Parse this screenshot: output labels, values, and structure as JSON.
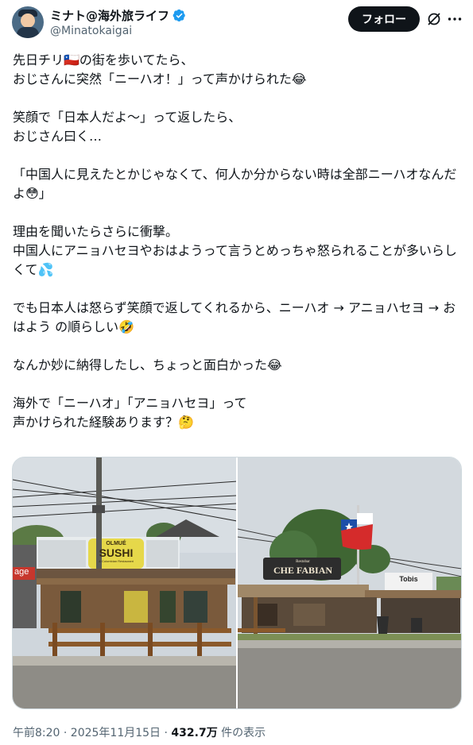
{
  "author": {
    "display_name": "ミナト@海外旅ライフ",
    "handle": "@Minatokaigai",
    "verified_color": "#1d9bf0"
  },
  "actions": {
    "follow_label": "フォロー",
    "grok_icon": "grok-icon",
    "more_icon": "more-icon"
  },
  "tweet": {
    "paragraphs": [
      "先日チリ🇨🇱の街を歩いてたら、\nおじさんに突然「ニーハオ！」って声かけられた😂",
      "笑顔で「日本人だよ〜」って返したら、\nおじさん曰く…",
      "「中国人に見えたとかじゃなくて、何人か分からない時は全部ニーハオなんだよ😳」",
      "理由を聞いたらさらに衝撃。\n中国人にアニョハセヨやおはようって言うとめっちゃ怒られることが多いらしくて💦",
      "でも日本人は怒らず笑顔で返してくれるから、ニーハオ → アニョハセヨ → おはよう の順らしい🤣",
      "なんか妙に納得したし、ちょっと面白かった😂",
      "海外で「ニーハオ」「アニョハセヨ」って\n声かけられた経験あります？🤔"
    ]
  },
  "media": {
    "photo1": {
      "sign_line1": "OLMUÉ",
      "sign_line2": "SUSHI",
      "sign_line3": "& Colombian Restaurant",
      "side_sign": "age"
    },
    "photo2": {
      "sign_main": "CHE FABIAN",
      "sign_small": "Restobar",
      "sign_right": "Tobis"
    }
  },
  "meta": {
    "timestamp": "午前8:20 · 2025年11月15日",
    "separator": " · ",
    "views_count": "432.7万",
    "views_label": " 件の表示"
  }
}
